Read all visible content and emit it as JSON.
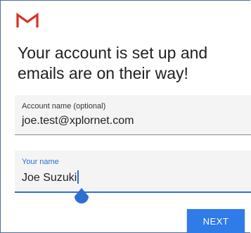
{
  "app": {
    "logo_icon": "gmail-logo-icon",
    "logo_color": "#d93025"
  },
  "headline": "Your account is set up and emails are on their way!",
  "account_field": {
    "label": "Account name (optional)",
    "value": "joe.test@xplornet.com"
  },
  "name_field": {
    "label": "Your name",
    "value": "Joe Suzuki",
    "focus_color": "#2f6fd4"
  },
  "next_button": {
    "label": "NEXT",
    "color": "#2f7be8"
  }
}
